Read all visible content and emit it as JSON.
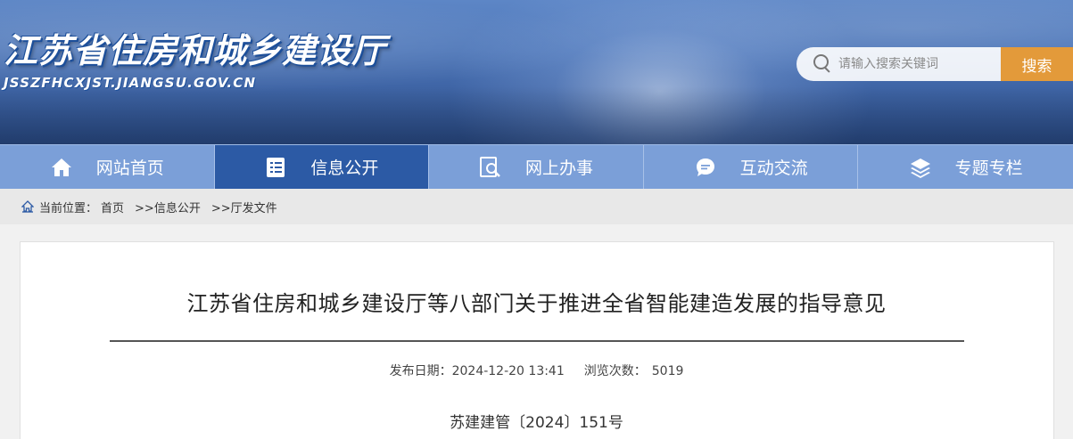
{
  "header": {
    "site_title": "江苏省住房和城乡建设厅",
    "site_domain": "JSSZFHCXJST.JIANGSU.GOV.CN"
  },
  "search": {
    "placeholder": "请输入搜索关键词",
    "button_label": "搜索"
  },
  "nav": {
    "items": [
      {
        "label": "网站首页",
        "icon": "home-icon"
      },
      {
        "label": "信息公开",
        "icon": "document-icon",
        "active": true
      },
      {
        "label": "网上办事",
        "icon": "search-document-icon"
      },
      {
        "label": "互动交流",
        "icon": "chat-bubble-icon"
      },
      {
        "label": "专题专栏",
        "icon": "layers-icon"
      }
    ]
  },
  "breadcrumb": {
    "prefix": "当前位置：",
    "items": [
      "首页",
      ">>信息公开",
      ">>厅发文件"
    ]
  },
  "article": {
    "title": "江苏省住房和城乡建设厅等八部门关于推进全省智能建造发展的指导意见",
    "publish_label": "发布日期：",
    "publish_date": "2024-12-20 13:41",
    "views_label": "浏览次数：",
    "views_count": "5019",
    "doc_number": "苏建建管〔2024〕151号"
  },
  "colors": {
    "nav_bg": "#7b9fd8",
    "nav_active": "#2c5aa5",
    "search_button": "#e39a3a",
    "header_blue": "#4d76b8"
  }
}
